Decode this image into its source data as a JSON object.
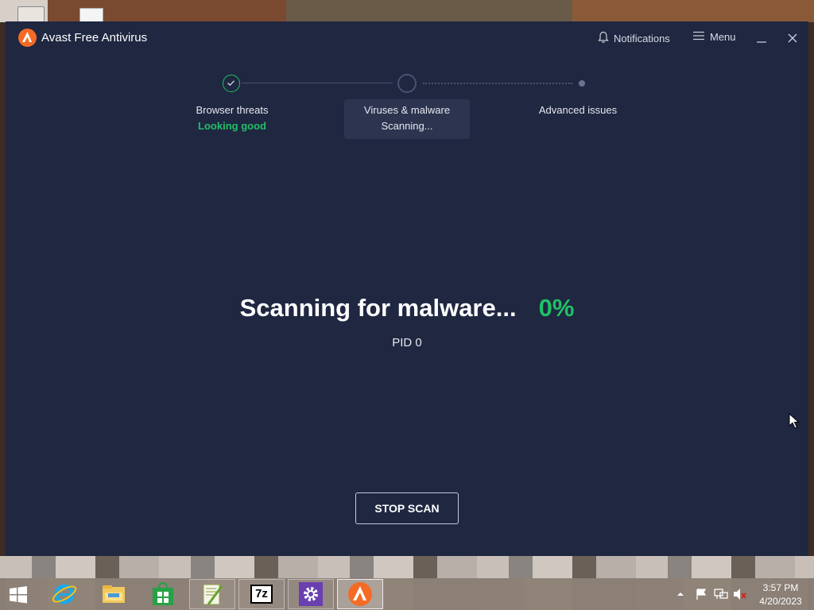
{
  "app": {
    "title": "Avast Free Antivirus",
    "notifications_label": "Notifications",
    "menu_label": "Menu",
    "brand_color": "#f46b26",
    "background_color": "#1f2741",
    "accent_green": "#21c067"
  },
  "steps": [
    {
      "title": "Browser threats",
      "status": "Looking good",
      "state": "done"
    },
    {
      "title": "Viruses & malware",
      "status": "Scanning...",
      "state": "active"
    },
    {
      "title": "Advanced issues",
      "status": "",
      "state": "pending"
    }
  ],
  "scan": {
    "heading": "Scanning for malware...",
    "percent": "0%",
    "detail": "PID 0",
    "stop_label": "STOP SCAN"
  },
  "taskbar": {
    "items": [
      "start-icon",
      "internet-explorer-icon",
      "file-explorer-icon",
      "store-icon",
      "notepad-plus-plus-icon",
      "7zip-icon",
      "settings-icon",
      "avast-icon"
    ],
    "sevenzip_label": "7z"
  },
  "clock": {
    "time": "3:57 PM",
    "date": "4/20/2023"
  }
}
